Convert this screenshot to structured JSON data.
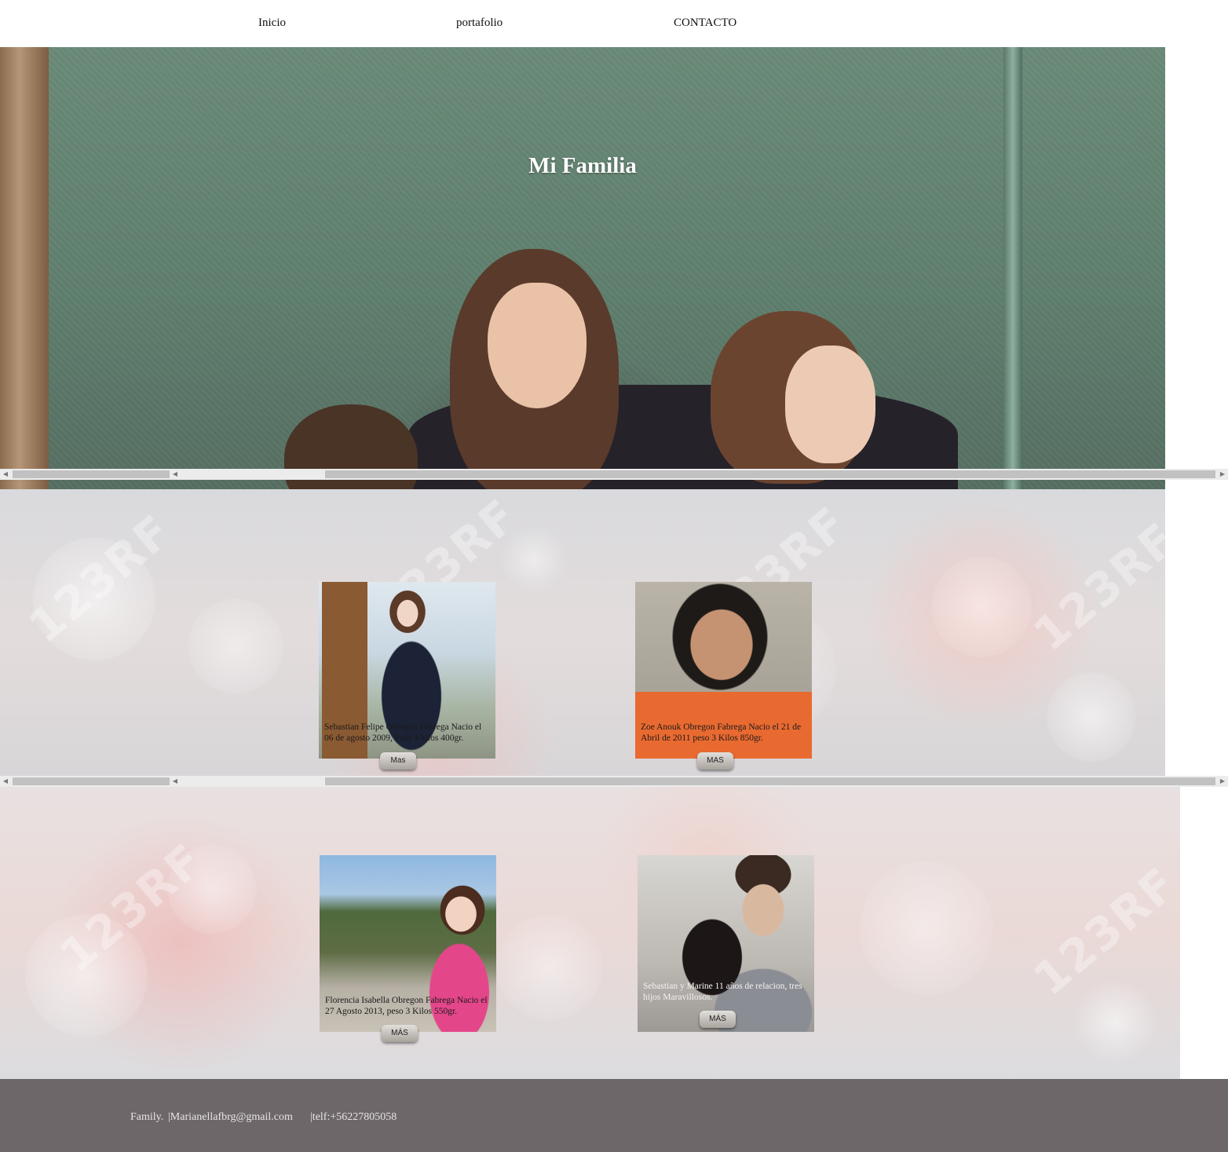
{
  "nav": {
    "items": [
      {
        "label": "Inicio"
      },
      {
        "label": "portafolio"
      },
      {
        "label": "CONTACTO"
      }
    ]
  },
  "hero": {
    "title": "Mi Familia"
  },
  "scrollbar": {
    "left_arrow": "◀",
    "right_arrow": "▶"
  },
  "watermark": "123RF",
  "cards": [
    {
      "caption": "Sebastian Felipe Obregon Fabrega Nacio el 06 de agosto 2009, Peso 4 kilos 400gr.",
      "button": "Mas"
    },
    {
      "caption": "Zoe Anouk Obregon Fabrega Nacio el 21 de Abril de 2011 peso 3 Kilos 850gr.",
      "button": "MAS"
    },
    {
      "caption": "Florencia Isabella Obregon Fabrega Nacio el 27 Agosto 2013, peso 3 Kilos 550gr.",
      "button": "MÁS"
    },
    {
      "caption": "Sebastian y Marine 11 años de relacion, tres hijos Maravillosos.",
      "button": "MÁS"
    }
  ],
  "footer": {
    "brand": "Family.",
    "email": "|Marianellafbrg@gmail.com",
    "phone": "|telf:+56227805058"
  }
}
